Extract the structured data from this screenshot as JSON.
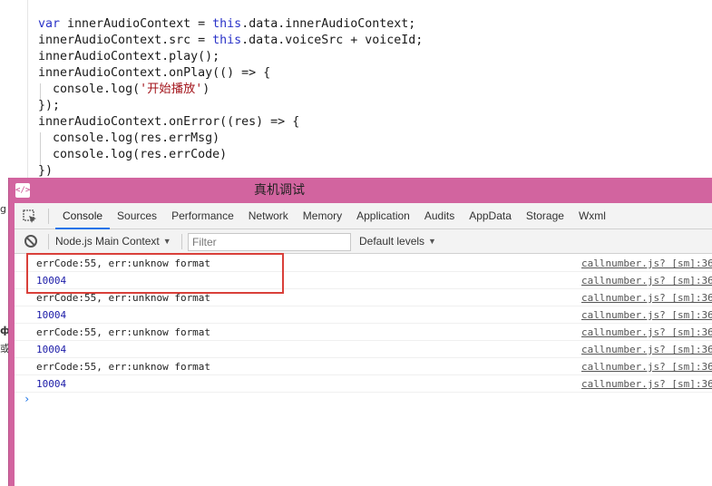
{
  "code_editor": {
    "lines": [
      [
        "",
        "var",
        " innerAudioContext = ",
        "this",
        ".data.innerAudioContext;"
      ],
      [
        "",
        "",
        "innerAudioContext.src = ",
        "this",
        ".data.voiceSrc + voiceId;"
      ],
      [
        "",
        "",
        "innerAudioContext.play();",
        "",
        ""
      ],
      [
        "",
        "",
        "innerAudioContext.onPlay(() => {",
        "",
        ""
      ],
      [
        "  ",
        "",
        "console.log(",
        "'开始播放'",
        ")"
      ],
      [
        "",
        "",
        "});",
        "",
        ""
      ],
      [
        "",
        "",
        "innerAudioContext.onError((res) => {",
        "",
        ""
      ],
      [
        "  ",
        "",
        "console.log(res.errMsg)",
        "",
        ""
      ],
      [
        "  ",
        "",
        "console.log(res.errCode)",
        "",
        ""
      ],
      [
        "",
        "",
        "})",
        "",
        ""
      ]
    ]
  },
  "behind_window": {
    "fragments": [
      "g",
      "ф",
      "或"
    ]
  },
  "devtools": {
    "window_title": "真机调试",
    "app_icon": "</>",
    "tabs": [
      "Console",
      "Sources",
      "Performance",
      "Network",
      "Memory",
      "Application",
      "Audits",
      "AppData",
      "Storage",
      "Wxml"
    ],
    "active_tab": "Console",
    "toolbar": {
      "context_label": "Node.js Main Context",
      "filter_placeholder": "Filter",
      "levels_label": "Default levels"
    },
    "console_messages": [
      {
        "text": "errCode:55, err:unknow format",
        "type": "log",
        "source": "callnumber.js? [sm]:36"
      },
      {
        "text": "10004",
        "type": "number",
        "source": "callnumber.js? [sm]:36"
      },
      {
        "text": "errCode:55, err:unknow format",
        "type": "log",
        "source": "callnumber.js? [sm]:36"
      },
      {
        "text": "10004",
        "type": "number",
        "source": "callnumber.js? [sm]:36"
      },
      {
        "text": "errCode:55, err:unknow format",
        "type": "log",
        "source": "callnumber.js? [sm]:36"
      },
      {
        "text": "10004",
        "type": "number",
        "source": "callnumber.js? [sm]:36"
      },
      {
        "text": "errCode:55, err:unknow format",
        "type": "log",
        "source": "callnumber.js? [sm]:36"
      },
      {
        "text": "10004",
        "type": "number",
        "source": "callnumber.js? [sm]:36"
      }
    ],
    "prompt_glyph": "›"
  },
  "colors": {
    "titlebar": "#d2649f",
    "highlight_box": "#d9403a",
    "keyword": "#2a33c8",
    "string": "#a3151c",
    "number_output": "#1c1ca8",
    "active_tab_underline": "#1a73e8"
  }
}
